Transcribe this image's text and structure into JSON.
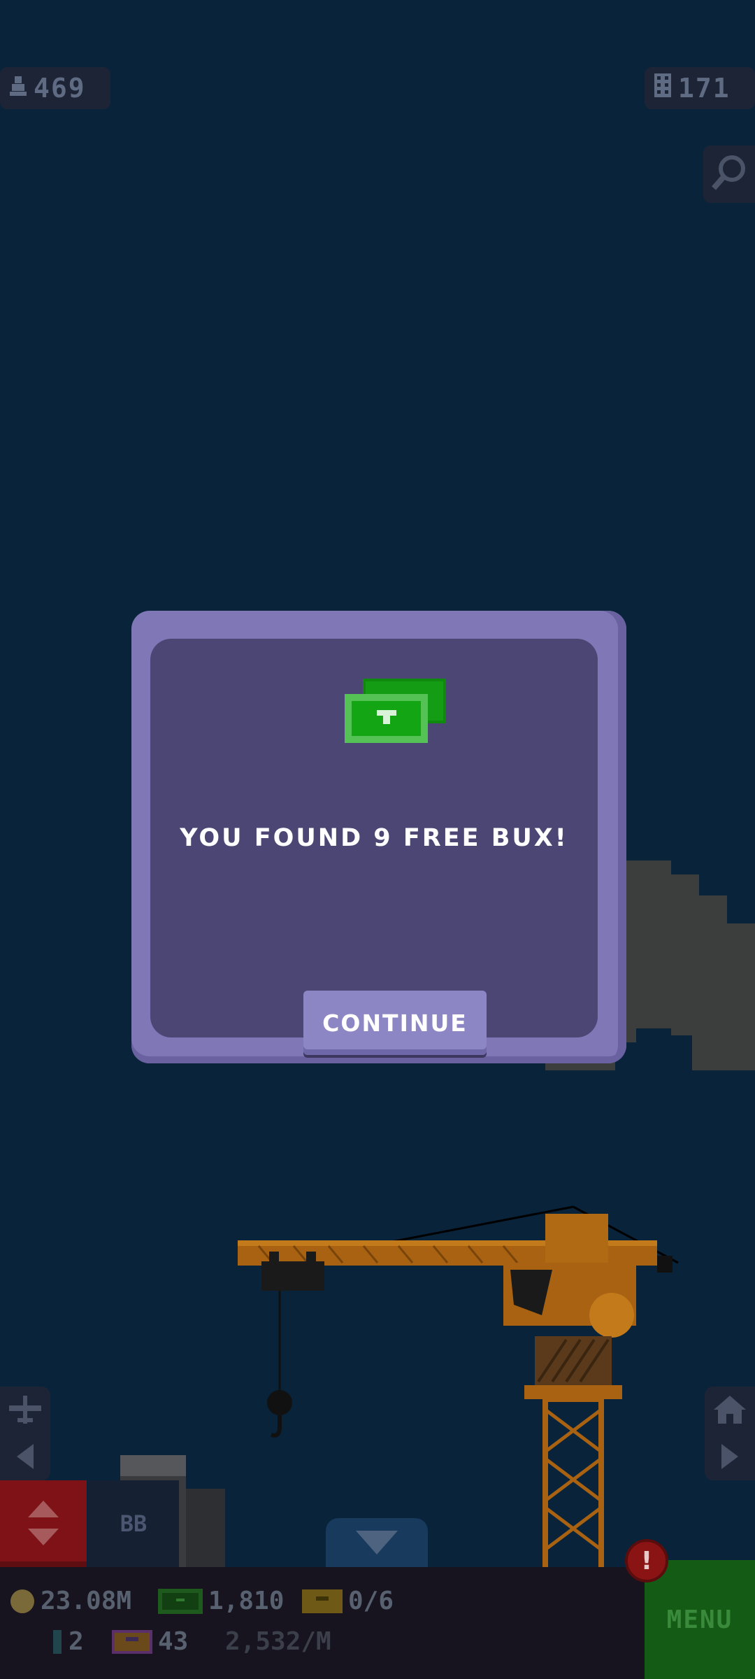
{
  "hud": {
    "population": "469",
    "floors": "171"
  },
  "dialog": {
    "message": "YOU FOUND 9 FREE BUX!",
    "continue_label": "CONTINUE"
  },
  "bottom": {
    "coins": "23.08M",
    "bux": "1,810",
    "tickets": "0/6",
    "keys": "2",
    "golden_tickets": "43",
    "rate": "2,532/M",
    "bb_label": "BB",
    "menu_label": "MENU",
    "alert": "!"
  },
  "colors": {
    "sky": "#08233a",
    "dialog_outer": "#7f77b6",
    "dialog_inner": "#4b4673",
    "bux_green": "#1aa81a",
    "menu_green": "#145b16"
  }
}
